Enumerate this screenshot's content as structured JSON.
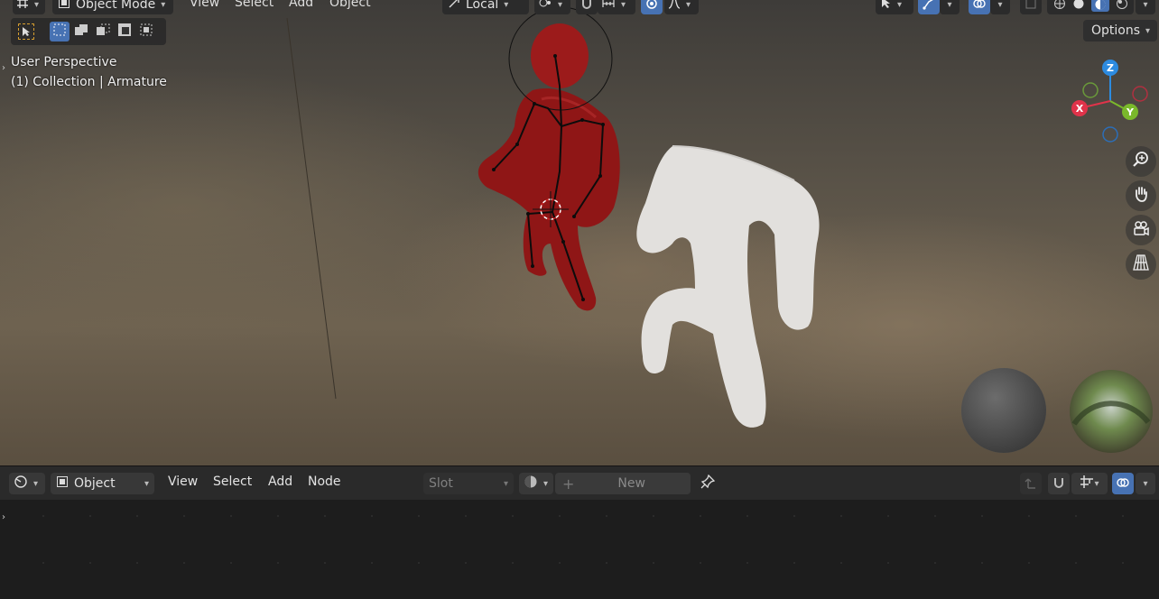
{
  "top_header": {
    "mode_label": "Object Mode",
    "menus": [
      "View",
      "Select",
      "Add",
      "Object"
    ],
    "transform_orientation": "Local"
  },
  "viewport": {
    "perspective_label": "User Perspective",
    "collection_label": "(1) Collection | Armature",
    "options_label": "Options",
    "gizmo": {
      "z": "Z",
      "x": "X",
      "y": "Y"
    }
  },
  "node_editor_header": {
    "editor_type_icon": "shader-editor-icon",
    "object_dropdown": "Object",
    "menus": [
      "View",
      "Select",
      "Add",
      "Node"
    ],
    "slot_placeholder": "Slot",
    "new_button": "New"
  },
  "colors": {
    "accent": "#4772b3",
    "axis_x": "#e0334a",
    "axis_y": "#7ab92b",
    "axis_z": "#2c8be0",
    "red_figure": "#9e1a1a",
    "white_figure": "#e4e2df"
  }
}
